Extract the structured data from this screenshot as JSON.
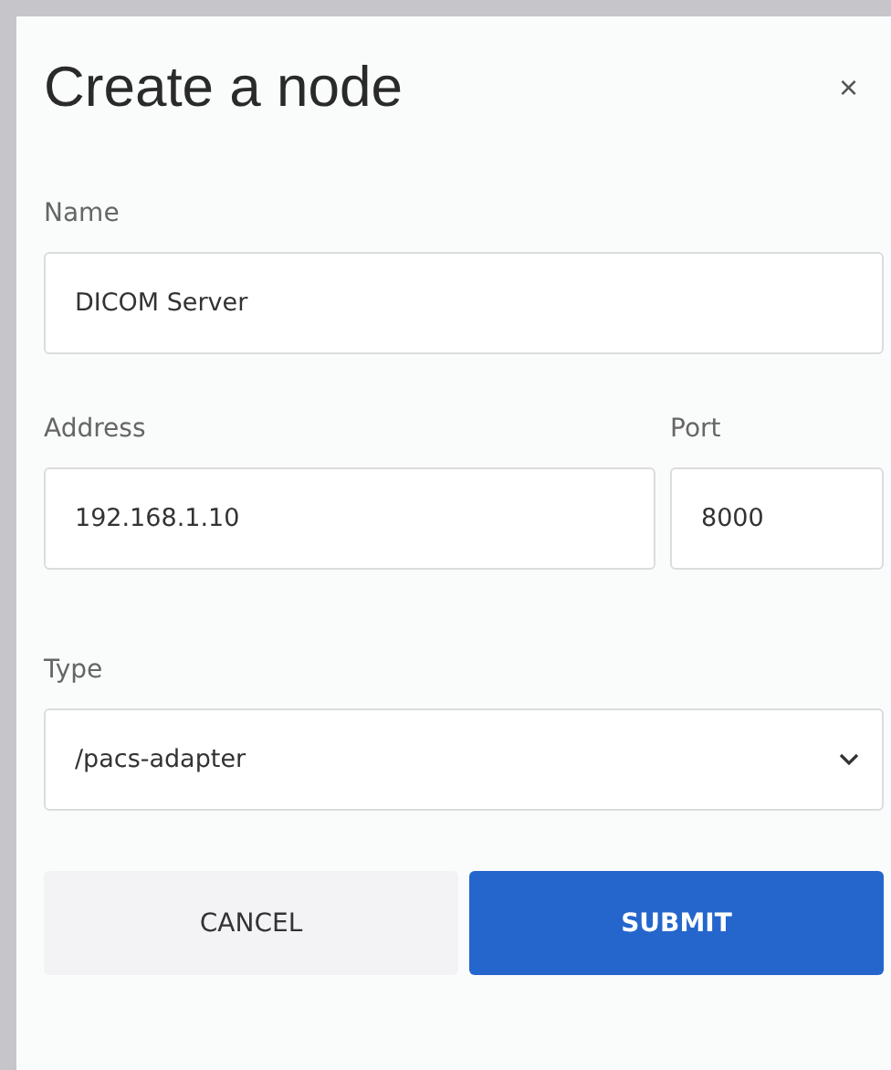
{
  "dialog": {
    "title": "Create a node",
    "close": "×"
  },
  "fields": [
    {
      "label": "Name",
      "value": "DICOM Server",
      "kind": "text"
    }
  ],
  "address_row": [
    {
      "label": "Address",
      "value": "192.168.1.10",
      "kind": "text"
    },
    {
      "label": "Port",
      "value": "8000",
      "kind": "text"
    }
  ],
  "type_field": {
    "label": "Type",
    "value": "/pacs-adapter",
    "kind": "select"
  },
  "buttons": [
    {
      "label": "CANCEL",
      "kind": "secondary"
    },
    {
      "label": "SUBMIT",
      "kind": "primary"
    }
  ]
}
